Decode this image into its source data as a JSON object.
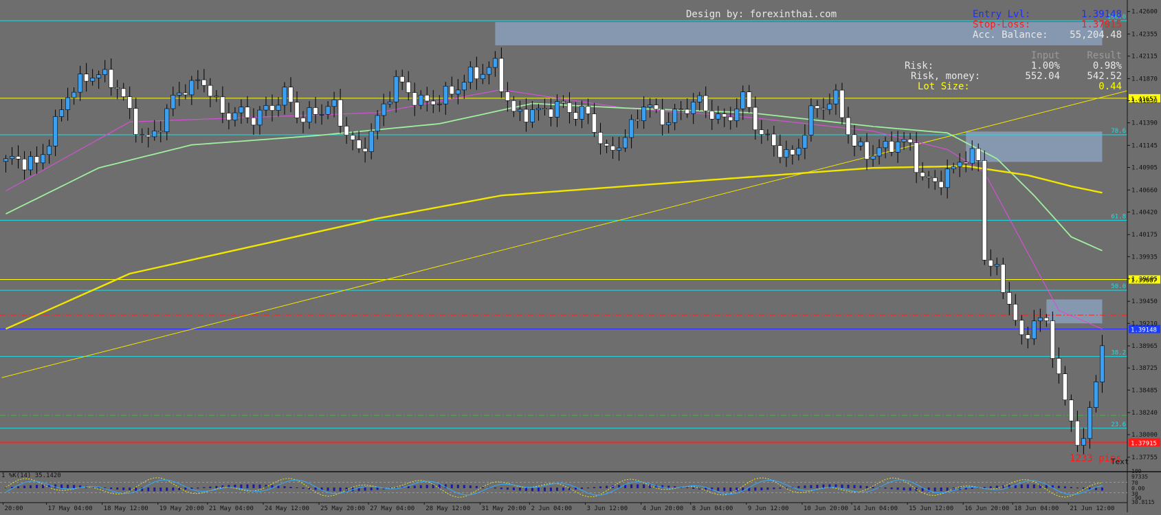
{
  "colors": {
    "background": "#6e6e6e",
    "bull_candle": "#3d9ff0",
    "bear_candle": "#ffffff",
    "wick": "#000000",
    "fib_line": "#19e0e8",
    "level_yellow": "#ffff00",
    "entry_line": "#2a2aff",
    "stop_line": "#ff2222",
    "ma_magenta": "#d451d4",
    "ma_green": "#9ff09f",
    "ma_yellow": "#f2e600",
    "trendline": "#f2e600",
    "zone": "#8aa0bc",
    "text_white": "#e8e8e8",
    "text_blue": "#1f2cff",
    "text_red": "#ff1a1a",
    "text_yellow": "#ffff00"
  },
  "header": {
    "design_credit": "Design by: forexinthai.com"
  },
  "panel": {
    "entry_label": "Entry Lvl:",
    "entry_value": "1.39148",
    "stop_label": "Stop-Loss:",
    "stop_value": "1.37915",
    "balance_label": "Acc. Balance:",
    "balance_value": "55,204.48",
    "col_input": "Input",
    "col_result": "Result",
    "risk_label": "Risk:",
    "risk_input": "1.00%",
    "risk_result": "0.98%",
    "risk_money_label": "Risk, money:",
    "risk_money_input": "552.04",
    "risk_money_result": "542.52",
    "lot_label": "Lot Size:",
    "lot_value": "0.44"
  },
  "pips_label": "1233 pips",
  "text_label": "Text",
  "indicator": {
    "label": "1 %K(14) 35.1420",
    "scale": [
      "100",
      "97335",
      "70",
      "0.00",
      "30",
      "-90",
      "30.8115"
    ]
  },
  "chart_data": {
    "type": "candlestick",
    "y_range": [
      1.3762,
      1.4268
    ],
    "y_ticks": [
      "1.42600",
      "1.42355",
      "1.42115",
      "1.41870",
      "1.41630",
      "1.41390",
      "1.41145",
      "1.40905",
      "1.40660",
      "1.40420",
      "1.40175",
      "1.39935",
      "1.39695",
      "1.39450",
      "1.39210",
      "1.38965",
      "1.38725",
      "1.38485",
      "1.38240",
      "1.38000",
      "1.37755"
    ],
    "y_tick_values": [
      1.426,
      1.42355,
      1.42115,
      1.4187,
      1.4163,
      1.4139,
      1.41145,
      1.40905,
      1.4066,
      1.4042,
      1.40175,
      1.39935,
      1.39695,
      1.3945,
      1.3921,
      1.38965,
      1.38725,
      1.38485,
      1.3824,
      1.38,
      1.37755
    ],
    "x_labels": [
      "20:00",
      "17 May 04:00",
      "18 May 12:00",
      "19 May 20:00",
      "21 May 04:00",
      "24 May 12:00",
      "25 May 20:00",
      "27 May 04:00",
      "28 May 12:00",
      "31 May 20:00",
      "2 Jun 04:00",
      "3 Jun 12:00",
      "4 Jun 20:00",
      "8 Jun 04:00",
      "9 Jun 12:00",
      "10 Jun 20:00",
      "14 Jun 04:00",
      "15 Jun 12:00",
      "16 Jun 20:00",
      "18 Jun 04:00",
      "21 Jun 12:00"
    ],
    "x_label_index": [
      0,
      7,
      16,
      25,
      33,
      42,
      51,
      59,
      68,
      77,
      85,
      94,
      103,
      111,
      120,
      129,
      137,
      146,
      155,
      163,
      172
    ],
    "levels": [
      {
        "label": "100.0",
        "value": 1.425,
        "kind": "fib"
      },
      {
        "label": "1.41657",
        "value": 1.41657,
        "kind": "yellow"
      },
      {
        "label": "78.6",
        "value": 1.4126,
        "kind": "fib"
      },
      {
        "label": "61.8",
        "value": 1.4033,
        "kind": "fib"
      },
      {
        "label": "1.39687",
        "value": 1.39687,
        "kind": "yellow"
      },
      {
        "label": "50.0",
        "value": 1.3957,
        "kind": "fib"
      },
      {
        "label": "1.39148",
        "value": 1.39148,
        "kind": "entry"
      },
      {
        "label": "38.2",
        "value": 1.3885,
        "kind": "fib"
      },
      {
        "label": "23.6",
        "value": 1.3807,
        "kind": "fib"
      },
      {
        "label": "1.37915",
        "value": 1.37915,
        "kind": "stop"
      }
    ],
    "dashed_levels": [
      {
        "value": 1.393,
        "color": "#ff2222"
      },
      {
        "value": 1.3821,
        "color": "#22cc22"
      }
    ],
    "trendline": {
      "from": [
        0,
        1.3862
      ],
      "to": [
        181,
        1.41737
      ]
    },
    "zones": [
      {
        "i0": 79,
        "i1": 177,
        "top": 1.42485,
        "bottom": 1.42232
      },
      {
        "i0": 155,
        "i1": 177,
        "top": 1.41295,
        "bottom": 1.40965
      },
      {
        "i0": 168,
        "i1": 177,
        "top": 1.3947,
        "bottom": 1.3921
      }
    ],
    "ohlc_anchors": [
      [
        0,
        1.4097
      ],
      [
        5,
        1.409
      ],
      [
        10,
        1.4175
      ],
      [
        14,
        1.4188
      ],
      [
        18,
        1.418
      ],
      [
        21,
        1.414
      ],
      [
        23,
        1.412
      ],
      [
        25,
        1.4135
      ],
      [
        28,
        1.417
      ],
      [
        32,
        1.419
      ],
      [
        35,
        1.415
      ],
      [
        40,
        1.414
      ],
      [
        45,
        1.4175
      ],
      [
        48,
        1.414
      ],
      [
        53,
        1.4155
      ],
      [
        57,
        1.411
      ],
      [
        60,
        1.414
      ],
      [
        63,
        1.418
      ],
      [
        67,
        1.4165
      ],
      [
        72,
        1.417
      ],
      [
        75,
        1.4185
      ],
      [
        79,
        1.4205
      ],
      [
        82,
        1.415
      ],
      [
        86,
        1.4145
      ],
      [
        90,
        1.416
      ],
      [
        94,
        1.415
      ],
      [
        97,
        1.41
      ],
      [
        100,
        1.412
      ],
      [
        103,
        1.4165
      ],
      [
        107,
        1.414
      ],
      [
        112,
        1.416
      ],
      [
        116,
        1.4145
      ],
      [
        119,
        1.4165
      ],
      [
        122,
        1.412
      ],
      [
        127,
        1.4105
      ],
      [
        130,
        1.415
      ],
      [
        134,
        1.416
      ],
      [
        137,
        1.4115
      ],
      [
        140,
        1.411
      ],
      [
        143,
        1.4115
      ],
      [
        146,
        1.411
      ],
      [
        148,
        1.4075
      ],
      [
        152,
        1.4085
      ],
      [
        154,
        1.41
      ],
      [
        157,
        1.4095
      ],
      [
        158,
        1.399
      ],
      [
        160,
        1.3975
      ],
      [
        162,
        1.395
      ],
      [
        164,
        1.3905
      ],
      [
        166,
        1.3925
      ],
      [
        168,
        1.3915
      ],
      [
        170,
        1.386
      ],
      [
        171,
        1.383
      ],
      [
        173,
        1.38
      ],
      [
        174,
        1.3795
      ],
      [
        175,
        1.383
      ],
      [
        176,
        1.3865
      ],
      [
        177,
        1.3905
      ]
    ],
    "ma_magenta": [
      [
        0,
        1.4065
      ],
      [
        20,
        1.414
      ],
      [
        40,
        1.4145
      ],
      [
        60,
        1.415
      ],
      [
        80,
        1.4175
      ],
      [
        100,
        1.4155
      ],
      [
        120,
        1.4145
      ],
      [
        140,
        1.413
      ],
      [
        152,
        1.411
      ],
      [
        158,
        1.4085
      ],
      [
        164,
        1.401
      ],
      [
        170,
        1.3935
      ],
      [
        177,
        1.3915
      ]
    ],
    "ma_green": [
      [
        0,
        1.404
      ],
      [
        15,
        1.409
      ],
      [
        30,
        1.4115
      ],
      [
        50,
        1.4125
      ],
      [
        70,
        1.4138
      ],
      [
        85,
        1.416
      ],
      [
        100,
        1.4155
      ],
      [
        120,
        1.415
      ],
      [
        140,
        1.4135
      ],
      [
        152,
        1.4128
      ],
      [
        160,
        1.41
      ],
      [
        166,
        1.406
      ],
      [
        172,
        1.4015
      ],
      [
        177,
        1.4
      ]
    ],
    "ma_yellow": [
      [
        0,
        1.3915
      ],
      [
        20,
        1.3975
      ],
      [
        40,
        1.4005
      ],
      [
        60,
        1.4035
      ],
      [
        80,
        1.406
      ],
      [
        100,
        1.407
      ],
      [
        120,
        1.408
      ],
      [
        140,
        1.409
      ],
      [
        155,
        1.4092
      ],
      [
        165,
        1.4082
      ],
      [
        172,
        1.407
      ],
      [
        177,
        1.4063
      ]
    ]
  }
}
